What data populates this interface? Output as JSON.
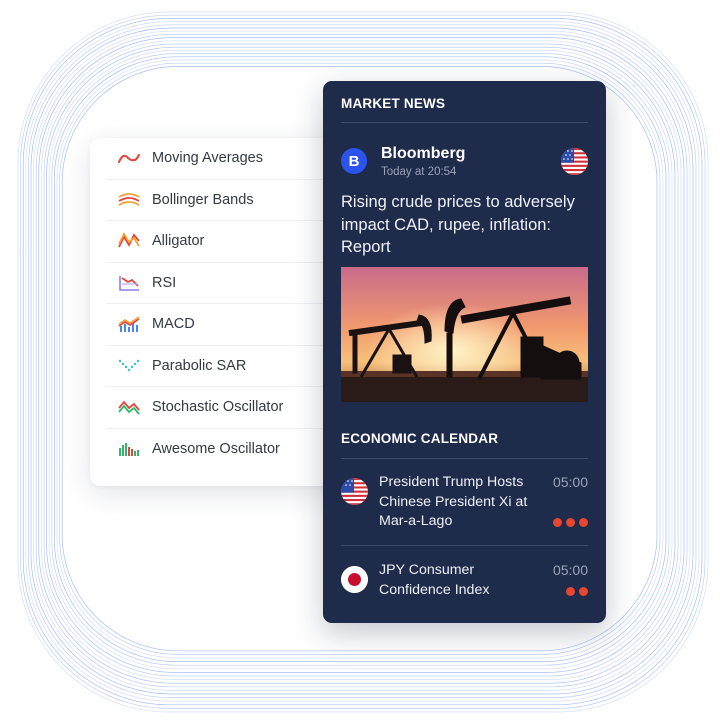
{
  "indicators": [
    {
      "label": "Moving Averages",
      "icon": "moving-averages-icon"
    },
    {
      "label": "Bollinger Bands",
      "icon": "bollinger-bands-icon"
    },
    {
      "label": "Alligator",
      "icon": "alligator-icon"
    },
    {
      "label": "RSI",
      "icon": "rsi-icon"
    },
    {
      "label": "MACD",
      "icon": "macd-icon"
    },
    {
      "label": "Parabolic SAR",
      "icon": "parabolic-sar-icon"
    },
    {
      "label": "Stochastic Oscillator",
      "icon": "stochastic-oscillator-icon"
    },
    {
      "label": "Awesome Oscillator",
      "icon": "awesome-oscillator-icon"
    }
  ],
  "news": {
    "title": "MARKET NEWS",
    "source": {
      "logo_letter": "B",
      "name": "Bloomberg",
      "time": "Today at 20:54",
      "flag": "us-flag-icon"
    },
    "headline": "Rising crude prices to adversely impact CAD, rupee, inflation: Report",
    "image": "oil-pumpjack-sunset-image"
  },
  "calendar": {
    "title": "ECONOMIC CALENDAR",
    "events": [
      {
        "title": "President Trump Hosts Chinese President Xi at Mar-a-Lago",
        "time": "05:00",
        "impact": 3,
        "flag": "us-flag-icon"
      },
      {
        "title": "JPY Consumer Confidence Index",
        "time": "05:00",
        "impact": 2,
        "flag": "japan-flag-icon"
      }
    ]
  },
  "colors": {
    "panel": "#1f2b4b",
    "accent": "#2b54ee",
    "impact": "#e8462f",
    "lines": "#4a7cf0"
  }
}
